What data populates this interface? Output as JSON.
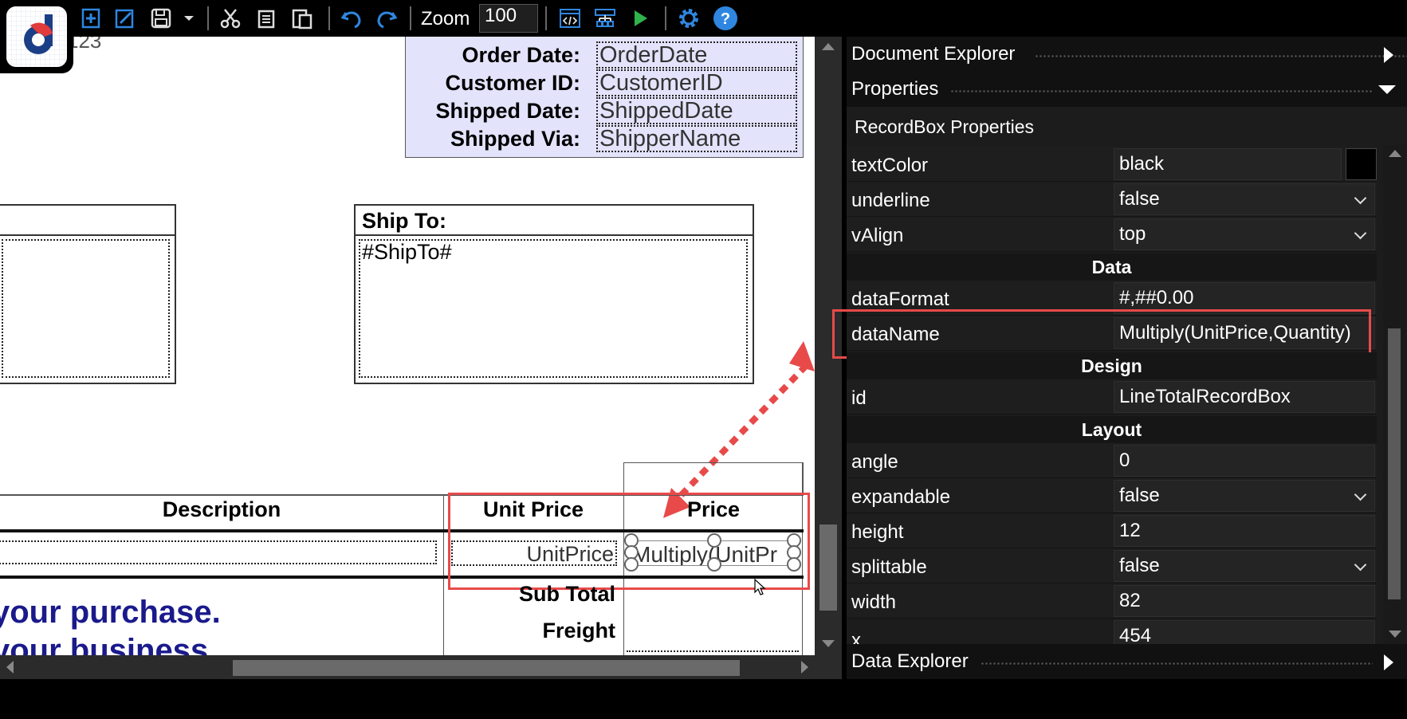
{
  "toolbar": {
    "zoom_label": "Zoom",
    "zoom_value": "100"
  },
  "canvas": {
    "order_info": {
      "order_date_label": "Order Date:",
      "order_date_value": "OrderDate",
      "customer_id_label": "Customer ID:",
      "customer_id_value": "CustomerID",
      "shipped_date_label": "Shipped Date:",
      "shipped_date_value": "ShippedDate",
      "shipped_via_label": "Shipped Via:",
      "shipped_via_value": "ShipperName"
    },
    "ship_to": {
      "title": "Ship To:",
      "value": "#ShipTo#"
    },
    "table": {
      "col_description": "Description",
      "col_unit_price": "Unit Price",
      "col_price": "Price",
      "unit_price_field": "UnitPrice",
      "price_field": "Multiply(UnitPr",
      "sub_total": "Sub Total",
      "freight": "Freight"
    },
    "footer_text_1": "your purchase.",
    "footer_text_2": "your business."
  },
  "panel": {
    "document_explorer": "Document Explorer",
    "properties": "Properties",
    "recordbox_properties": "RecordBox Properties",
    "data_explorer": "Data Explorer",
    "rows": [
      {
        "name": "textColor",
        "value": "black",
        "dropdown": false
      },
      {
        "name": "underline",
        "value": "false",
        "dropdown": true
      },
      {
        "name": "vAlign",
        "value": "top",
        "dropdown": true
      },
      {
        "name": "dataFormat",
        "value": "#,##0.00",
        "dropdown": false
      },
      {
        "name": "dataName",
        "value": "Multiply(UnitPrice,Quantity)",
        "dropdown": false
      },
      {
        "name": "id",
        "value": "LineTotalRecordBox",
        "dropdown": false
      },
      {
        "name": "angle",
        "value": "0",
        "dropdown": false
      },
      {
        "name": "expandable",
        "value": "false",
        "dropdown": true
      },
      {
        "name": "height",
        "value": "12",
        "dropdown": false
      },
      {
        "name": "splittable",
        "value": "false",
        "dropdown": true
      },
      {
        "name": "width",
        "value": "82",
        "dropdown": false
      },
      {
        "name": "x",
        "value": "454",
        "dropdown": false
      }
    ],
    "groups": {
      "data": "Data",
      "design": "Design",
      "layout": "Layout"
    }
  },
  "colors": {
    "accent_blue": "#1e78d6",
    "highlight_red": "#e84a4a",
    "order_box_bg": "#e3e3fb",
    "footer_text": "#1a1a8c"
  }
}
